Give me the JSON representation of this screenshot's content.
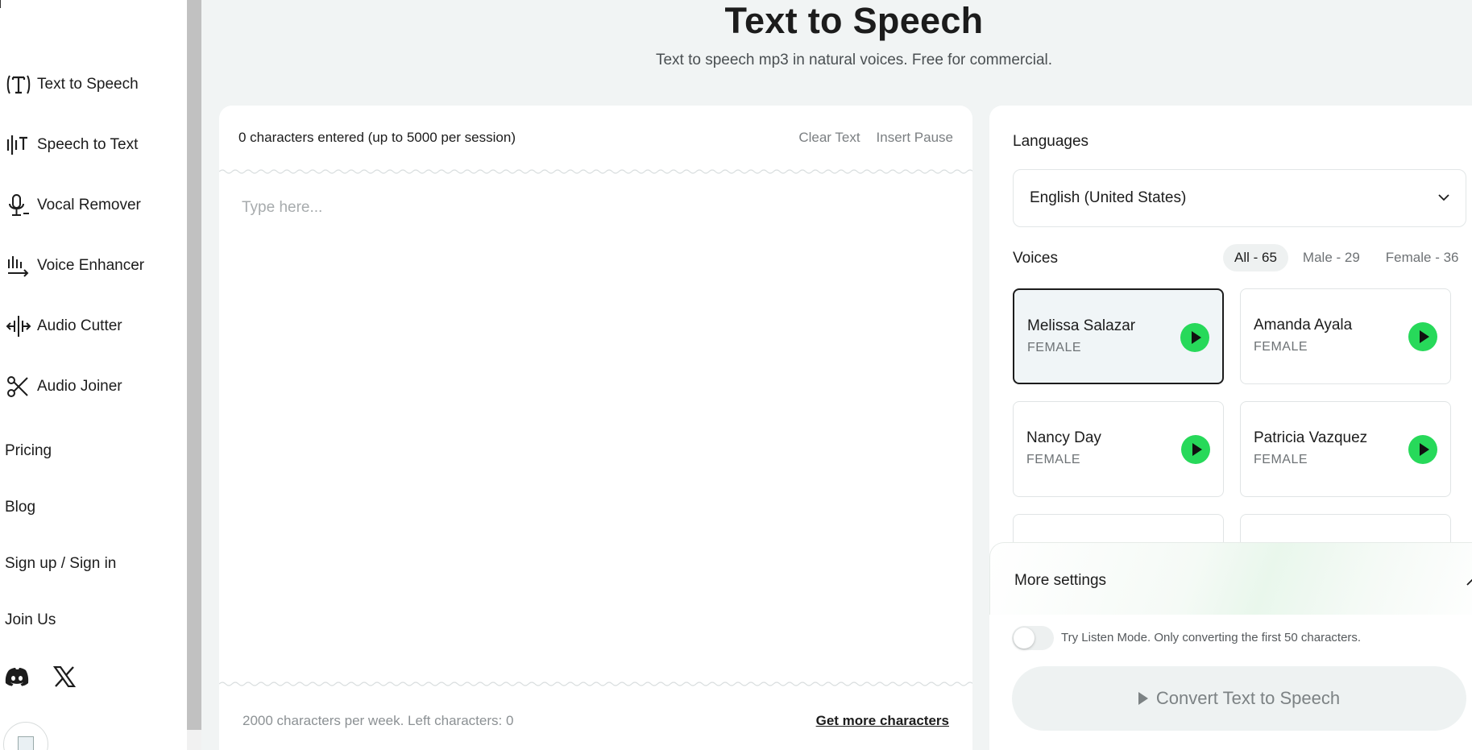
{
  "sidebar": {
    "items": [
      {
        "label": "Text to Speech",
        "icon": "text-to-speech-icon"
      },
      {
        "label": "Speech to Text",
        "icon": "waveform-text-icon"
      },
      {
        "label": "Vocal Remover",
        "icon": "microphone-icon"
      },
      {
        "label": "Voice Enhancer",
        "icon": "voice-enhancer-icon"
      },
      {
        "label": "Audio Cutter",
        "icon": "audio-cutter-icon"
      },
      {
        "label": "Audio Joiner",
        "icon": "scissors-icon"
      }
    ],
    "links": [
      "Pricing",
      "Blog",
      "Sign up / Sign in",
      "Join Us"
    ],
    "social": [
      "discord-icon",
      "x-icon"
    ]
  },
  "header": {
    "title": "Text to Speech",
    "subtitle": "Text to speech mp3 in natural voices. Free for commercial."
  },
  "editor": {
    "char_count": "0 characters entered (up to 5000 per session)",
    "clear_label": "Clear Text",
    "pause_label": "Insert Pause",
    "placeholder": "Type here...",
    "value": "",
    "weekly_limit": "2000 characters per week. Left characters: 0",
    "more_chars_label": "Get more characters"
  },
  "languages": {
    "title": "Languages",
    "selected": "English (United States)"
  },
  "voices": {
    "title": "Voices",
    "filters": [
      "All - 65",
      "Male - 29",
      "Female - 36"
    ],
    "active_filter": "All - 65",
    "list": [
      {
        "name": "Melissa Salazar",
        "gender": "FEMALE",
        "selected": true
      },
      {
        "name": "Amanda Ayala",
        "gender": "FEMALE",
        "selected": false
      },
      {
        "name": "Nancy Day",
        "gender": "FEMALE",
        "selected": false
      },
      {
        "name": "Patricia Vazquez",
        "gender": "FEMALE",
        "selected": false
      }
    ]
  },
  "settings": {
    "label": "More settings",
    "listen_mode_label": "Try Listen Mode. Only converting the first 50 characters.",
    "listen_mode_on": false,
    "convert_label": "Convert Text to Speech"
  },
  "colors": {
    "accent_green": "#27d95a",
    "background": "#f1f4f4",
    "text": "#1c1c1c"
  }
}
